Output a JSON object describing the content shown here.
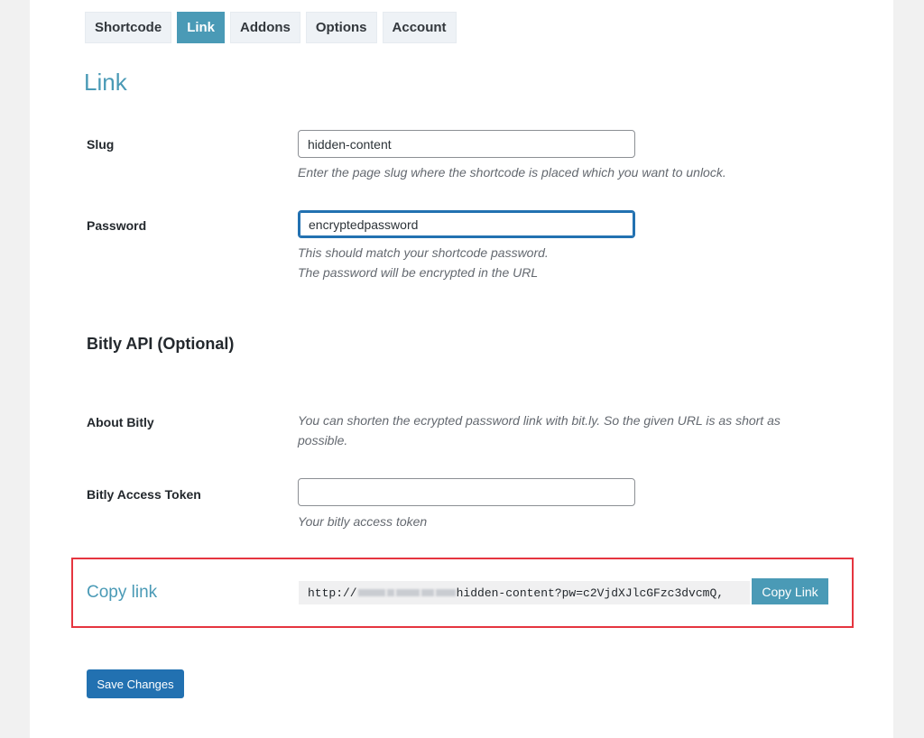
{
  "tabs": [
    {
      "label": "Shortcode",
      "active": false
    },
    {
      "label": "Link",
      "active": true
    },
    {
      "label": "Addons",
      "active": false
    },
    {
      "label": "Options",
      "active": false
    },
    {
      "label": "Account",
      "active": false
    }
  ],
  "page_title": "Link",
  "slug": {
    "label": "Slug",
    "value": "hidden-content",
    "description": "Enter the page slug where the shortcode is placed which you want to unlock."
  },
  "password": {
    "label": "Password",
    "value": "encryptedpassword",
    "description_line1": "This should match your shortcode password.",
    "description_line2": "The password will be encrypted in the URL"
  },
  "bitly_section": {
    "title": "Bitly API (Optional)",
    "about_label": "About Bitly",
    "about_text": "You can shorten the ecrypted password link with bit.ly. So the given URL is as short as possible.",
    "token_label": "Bitly Access Token",
    "token_value": "",
    "token_description": "Your bitly access token"
  },
  "copy_link": {
    "label": "Copy link",
    "url_prefix": "http://",
    "url_suffix": "hidden-content?pw=c2VjdXJlcGFzc3dvcmQ,",
    "button_label": "Copy Link"
  },
  "colors": {
    "accent": "#4a9ab6",
    "primary_button": "#2271b1",
    "highlight_border": "#e5353f"
  },
  "save_button_label": "Save Changes"
}
